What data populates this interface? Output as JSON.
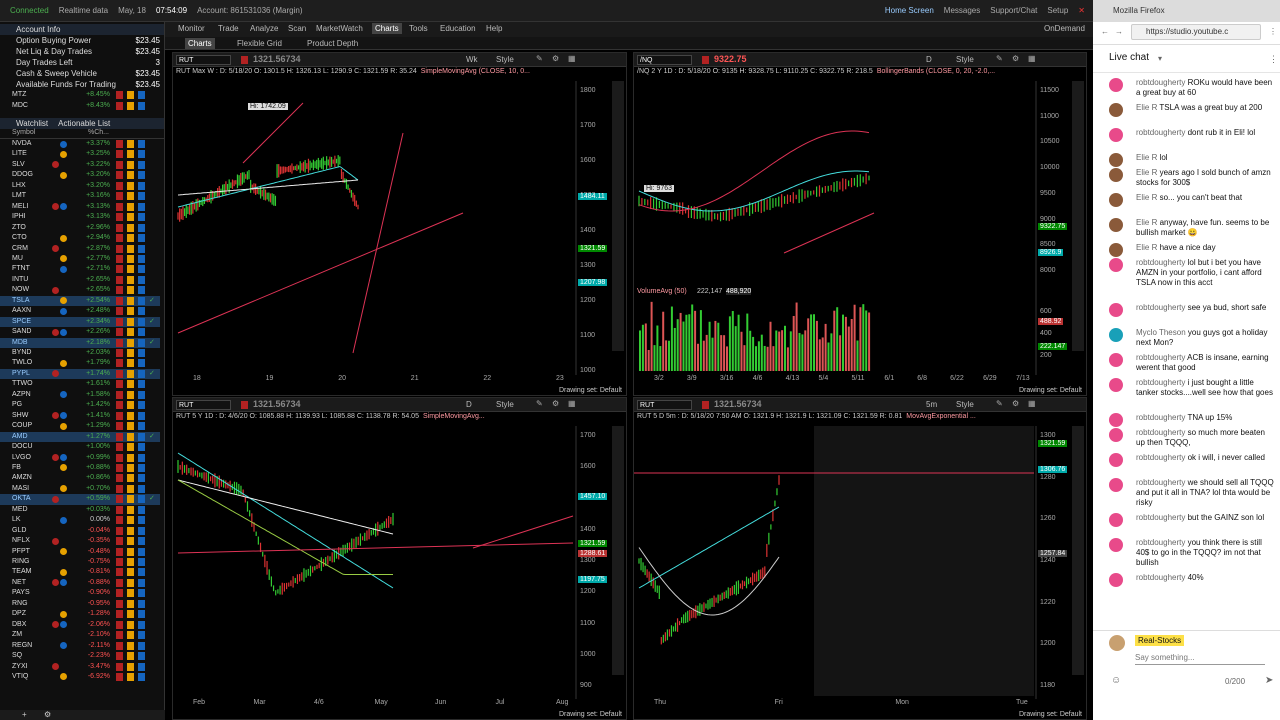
{
  "topbar": {
    "status": "Connected",
    "data": "Realtime data",
    "date": "May, 18",
    "time": "07:54:09",
    "account": "Account: 861531036 (Margin)",
    "home": "Home Screen",
    "messages": "Messages",
    "support": "Support/Chat",
    "setup": "Setup"
  },
  "nav": {
    "tabs": [
      "Monitor",
      "Trade",
      "Analyze",
      "Scan",
      "MarketWatch",
      "Charts",
      "Tools",
      "Education",
      "Help"
    ],
    "subtabs": [
      "Charts",
      "Flexible Grid",
      "Product Depth"
    ],
    "ondemand": "OnDemand"
  },
  "account_info": {
    "title": "Account Info",
    "rows": [
      {
        "label": "Option Buying Power",
        "value": "$23.45"
      },
      {
        "label": "Net Liq & Day Trades",
        "value": "$23.45"
      },
      {
        "label": "Day Trades Left",
        "value": "3"
      },
      {
        "label": "Cash & Sweep Vehicle",
        "value": "$23.45"
      },
      {
        "label": "Available Funds For Trading",
        "value": "$23.45"
      }
    ],
    "extra": [
      {
        "sym": "MTZ",
        "chg": "+8.45%"
      },
      {
        "sym": "MDC",
        "chg": "+8.43%"
      }
    ]
  },
  "watchlist": {
    "tabs": [
      "Watchlist",
      "Actionable List"
    ],
    "headers": [
      "Symbol",
      "%Ch..."
    ],
    "rows": [
      {
        "sym": "NVDA",
        "chg": "+3.37%"
      },
      {
        "sym": "LITE",
        "chg": "+3.25%"
      },
      {
        "sym": "SLV",
        "chg": "+3.22%"
      },
      {
        "sym": "DDOG",
        "chg": "+3.20%"
      },
      {
        "sym": "LHX",
        "chg": "+3.20%"
      },
      {
        "sym": "LMT",
        "chg": "+3.16%"
      },
      {
        "sym": "MELI",
        "chg": "+3.13%"
      },
      {
        "sym": "IPHI",
        "chg": "+3.13%"
      },
      {
        "sym": "ZTO",
        "chg": "+2.96%"
      },
      {
        "sym": "CTO",
        "chg": "+2.94%"
      },
      {
        "sym": "CRM",
        "chg": "+2.87%"
      },
      {
        "sym": "MU",
        "chg": "+2.77%"
      },
      {
        "sym": "FTNT",
        "chg": "+2.71%"
      },
      {
        "sym": "INTU",
        "chg": "+2.65%"
      },
      {
        "sym": "NOW",
        "chg": "+2.65%"
      },
      {
        "sym": "TSLA",
        "chg": "+2.54%"
      },
      {
        "sym": "AAXN",
        "chg": "+2.48%"
      },
      {
        "sym": "SPCE",
        "chg": "+2.34%"
      },
      {
        "sym": "SAND",
        "chg": "+2.26%"
      },
      {
        "sym": "MDB",
        "chg": "+2.18%"
      },
      {
        "sym": "BYND",
        "chg": "+2.03%"
      },
      {
        "sym": "TWLO",
        "chg": "+1.79%"
      },
      {
        "sym": "PYPL",
        "chg": "+1.74%"
      },
      {
        "sym": "TTWO",
        "chg": "+1.61%"
      },
      {
        "sym": "AZPN",
        "chg": "+1.58%"
      },
      {
        "sym": "PG",
        "chg": "+1.42%"
      },
      {
        "sym": "SHW",
        "chg": "+1.41%"
      },
      {
        "sym": "COUP",
        "chg": "+1.29%"
      },
      {
        "sym": "AMD",
        "chg": "+1.27%"
      },
      {
        "sym": "DOCU",
        "chg": "+1.00%"
      },
      {
        "sym": "LVGO",
        "chg": "+0.99%"
      },
      {
        "sym": "FB",
        "chg": "+0.88%"
      },
      {
        "sym": "AMZN",
        "chg": "+0.86%"
      },
      {
        "sym": "MASI",
        "chg": "+0.70%"
      },
      {
        "sym": "OKTA",
        "chg": "+0.59%"
      },
      {
        "sym": "MED",
        "chg": "+0.03%"
      },
      {
        "sym": "LK",
        "chg": "0.00%"
      },
      {
        "sym": "GLD",
        "chg": "-0.04%"
      },
      {
        "sym": "NFLX",
        "chg": "-0.35%"
      },
      {
        "sym": "PFPT",
        "chg": "-0.48%"
      },
      {
        "sym": "RING",
        "chg": "-0.75%"
      },
      {
        "sym": "TEAM",
        "chg": "-0.81%"
      },
      {
        "sym": "NET",
        "chg": "-0.88%"
      },
      {
        "sym": "PAYS",
        "chg": "-0.90%"
      },
      {
        "sym": "RNG",
        "chg": "-0.95%"
      },
      {
        "sym": "DPZ",
        "chg": "-1.28%"
      },
      {
        "sym": "DBX",
        "chg": "-2.06%"
      },
      {
        "sym": "ZM",
        "chg": "-2.10%"
      },
      {
        "sym": "REGN",
        "chg": "-2.11%"
      },
      {
        "sym": "SQ",
        "chg": "-2.23%"
      },
      {
        "sym": "ZYXI",
        "chg": "-3.47%"
      },
      {
        "sym": "VTIQ",
        "chg": "-6.92%"
      }
    ]
  },
  "charts": {
    "tl": {
      "symbol": "RUT",
      "price": "1321.56734",
      "agg": "Wk",
      "info": "RUT Max W : D: 5/18/20  O: 1301.5  H: 1326.13  L: 1290.9  C: 1321.59  R: 35.24",
      "study": "SimpleMovingAvg (CLOSE, 10, 0...",
      "hi": "Hi: 1742.09",
      "y_ticks": [
        "1800",
        "1700",
        "1600",
        "1500",
        "1400",
        "1300",
        "1200",
        "1100",
        "1000"
      ],
      "x_ticks": [
        "18",
        "19",
        "20",
        "21",
        "22",
        "23"
      ],
      "price_tags": [
        "1484.11",
        "1321.59",
        "1207.98"
      ],
      "footer": "Drawing set: Default"
    },
    "tr": {
      "symbol": "/NQ",
      "price": "9322.75",
      "agg": "D",
      "info": "/NQ 2 Y 1D : D: 5/18/20  O: 9135  H: 9328.75  L: 9110.25  C: 9322.75  R: 218.5",
      "study": "BollingerBands (CLOSE, 0, 20, -2.0,...",
      "hi": "Hi: 9763",
      "volume_label": "VolumeAvg (50)",
      "volume_vals": [
        "222,147",
        "488,920"
      ],
      "y_ticks": [
        "11500",
        "11000",
        "10500",
        "10000",
        "9500",
        "9000",
        "8500",
        "8000"
      ],
      "vol_ticks": [
        "600",
        "400",
        "200"
      ],
      "x_ticks": [
        "3/2",
        "3/9",
        "3/16",
        "4/6",
        "4/13",
        "5/4",
        "5/11",
        "6/1",
        "6/8",
        "6/22",
        "6/29",
        "7/13"
      ],
      "price_tags": [
        "9322.75",
        "8926.9",
        "488.92",
        "222.147"
      ],
      "footer": "Drawing set: Default"
    },
    "bl": {
      "symbol": "RUT",
      "price": "1321.56734",
      "agg": "D",
      "info": "RUT 5 Y 1D : D: 4/6/20  O: 1085.88  H: 1139.93  L: 1085.88  C: 1138.78  R: 54.05",
      "study": "SimpleMovingAvg...",
      "y_ticks": [
        "1700",
        "1600",
        "1500",
        "1400",
        "1300",
        "1200",
        "1100",
        "1000",
        "900"
      ],
      "x_ticks": [
        "Feb",
        "Mar",
        "4/6",
        "May",
        "Jun",
        "Jul",
        "Aug"
      ],
      "price_tags": [
        "1457.10",
        "1321.59",
        "1288.61",
        "1197.75"
      ],
      "footer": "Drawing set: Default"
    },
    "br": {
      "symbol": "RUT",
      "price": "1321.56734",
      "agg": "5m",
      "info": "RUT 5 D 5m : D: 5/18/20 7:50 AM  O: 1321.9  H: 1321.9  L: 1321.09  C: 1321.59  R: 0.81",
      "study": "MovAvgExponential ...",
      "y_ticks": [
        "1300",
        "1280",
        "1260",
        "1240",
        "1220",
        "1200",
        "1180"
      ],
      "x_ticks": [
        "Thu",
        "Fri",
        "Mon",
        "Tue"
      ],
      "price_tags": [
        "1321.59",
        "1306.76",
        "1257.84"
      ],
      "footer": "Drawing set: Default"
    }
  },
  "firefox": {
    "title": "Mozilla Firefox",
    "url": "https://studio.youtube.c"
  },
  "chat": {
    "title": "Live chat",
    "messages": [
      {
        "author": "robtdougherty",
        "text": "ROKu would have been a great buy at 60",
        "color": "#e84a8a"
      },
      {
        "author": "Elie R",
        "text": "TSLA was a great buy at 200",
        "color": "#8a5a3a"
      },
      {
        "author": "robtdougherty",
        "text": "dont rub it in Eli! lol",
        "color": "#e84a8a"
      },
      {
        "author": "Elie R",
        "text": "lol",
        "color": "#8a5a3a"
      },
      {
        "author": "Elie R",
        "text": "years ago I sold bunch of amzn stocks for 300$",
        "color": "#8a5a3a"
      },
      {
        "author": "Elie R",
        "text": "so... you can't beat that",
        "color": "#8a5a3a"
      },
      {
        "author": "Elie R",
        "text": "anyway, have fun. seems to be bullish market 😀",
        "color": "#8a5a3a"
      },
      {
        "author": "Elie R",
        "text": "have a nice day",
        "color": "#8a5a3a"
      },
      {
        "author": "robtdougherty",
        "text": "lol but i bet you have AMZN in your portfolio, i cant afford TSLA now in this acct",
        "color": "#e84a8a"
      },
      {
        "author": "robtdougherty",
        "text": "see ya bud, short safe",
        "color": "#e84a8a"
      },
      {
        "author": "Myclo Theson",
        "text": "you guys got a holiday next Mon?",
        "color": "#19a0b8"
      },
      {
        "author": "robtdougherty",
        "text": "ACB is insane, earning werent that good",
        "color": "#e84a8a"
      },
      {
        "author": "robtdougherty",
        "text": "i just bought a little tanker stocks....well see how that goes",
        "color": "#e84a8a"
      },
      {
        "author": "robtdougherty",
        "text": "TNA up 15%",
        "color": "#e84a8a"
      },
      {
        "author": "robtdougherty",
        "text": "so much more beaten up then TQQQ,",
        "color": "#e84a8a"
      },
      {
        "author": "robtdougherty",
        "text": "ok i will, i never called",
        "color": "#e84a8a"
      },
      {
        "author": "robtdougherty",
        "text": "we should sell all TQQQ and put it all in TNA? lol thta would be risky",
        "color": "#e84a8a"
      },
      {
        "author": "robtdougherty",
        "text": "but the GAINZ son lol",
        "color": "#e84a8a"
      },
      {
        "author": "robtdougherty",
        "text": "you think there is still 40$ to go in the TQQQ? im not that bullish",
        "color": "#e84a8a"
      },
      {
        "author": "robtdougherty",
        "text": "40%",
        "color": "#e84a8a"
      }
    ],
    "channel": "Real-Stocks",
    "placeholder": "Say something...",
    "counter": "0/200"
  }
}
